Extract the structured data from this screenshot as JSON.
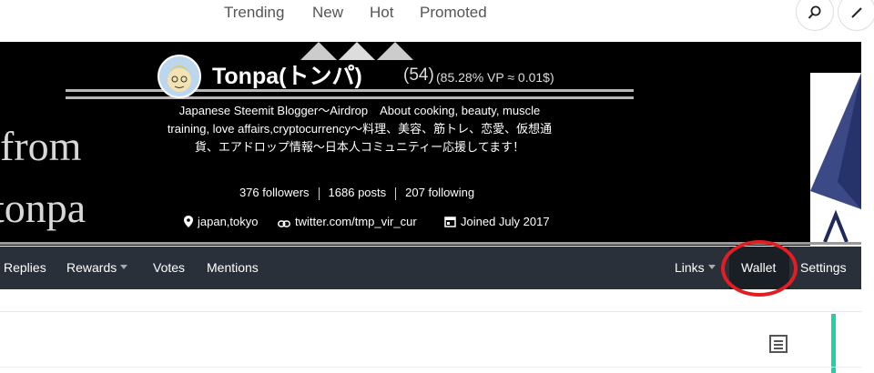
{
  "topnav": {
    "links": [
      "Trending",
      "New",
      "Hot",
      "Promoted"
    ]
  },
  "profile": {
    "name": "Tonpa(トンパ)",
    "reputation": "(54)",
    "voting_power": "(85.28% VP ≈ 0.01$)",
    "about": "Japanese Steemit Blogger〜Airdrop　About cooking, beauty, muscle training, love affairs,cryptocurrency〜料理、美容、筋トレ、恋愛、仮想通貨、エアドロップ情報〜日本人コミュニティー応援してます！",
    "followers": "376 followers",
    "posts": "1686 posts",
    "following": "207 following",
    "location": "japan,tokyo",
    "website": "twitter.com/tmp_vir_cur",
    "joined": "Joined July 2017"
  },
  "banner": {
    "text_line1": "from",
    "text_line2": "tonpa"
  },
  "tabs": {
    "replies": "Replies",
    "rewards": "Rewards",
    "votes": "Votes",
    "mentions": "Mentions",
    "links": "Links",
    "wallet": "Wallet",
    "settings": "Settings"
  },
  "colors": {
    "tab_bar": "#29303a",
    "annotation": "#e21d24",
    "accent": "#1fd1a4"
  }
}
